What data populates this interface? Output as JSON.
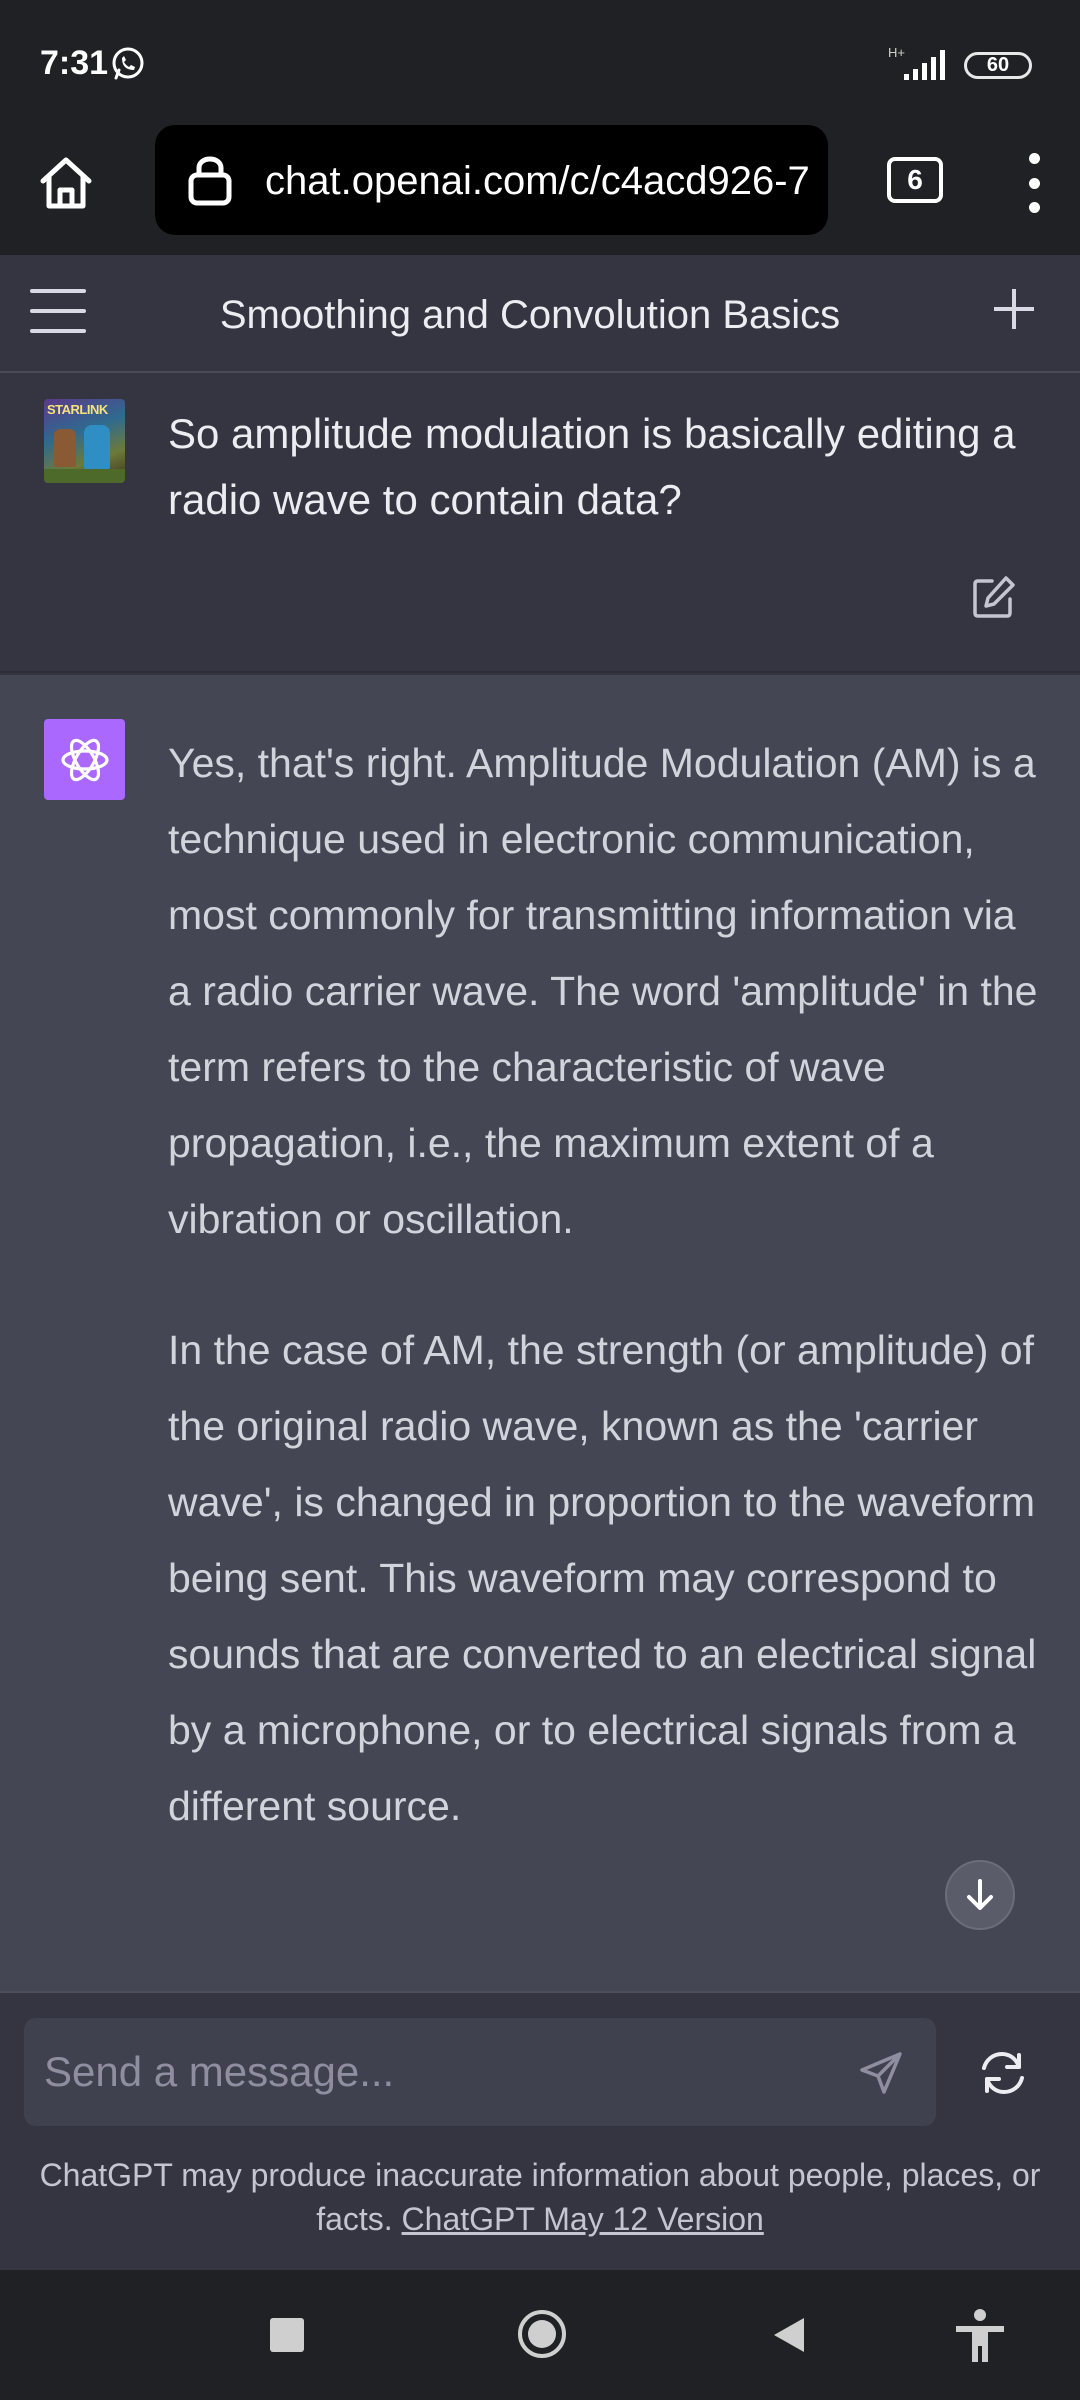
{
  "status_bar": {
    "time": "7:31",
    "network_type": "H+",
    "battery": "60"
  },
  "browser": {
    "url": "chat.openai.com/c/c4acd926-7",
    "tab_count": "6",
    "icons": [
      "home-icon",
      "lock-icon",
      "tabs-icon",
      "more-vert-icon"
    ]
  },
  "header": {
    "title": "Smoothing and Convolution Basics",
    "icons": [
      "menu-icon",
      "new-chat-icon"
    ]
  },
  "conversation": {
    "user_message": "So amplitude modulation is basically editing a radio wave to contain data?",
    "assistant_paragraphs": [
      "Yes, that's right. Amplitude Modulation (AM) is a technique used in electronic communication, most commonly for transmitting information via a radio carrier wave. The word 'amplitude' in the term refers to the characteristic of wave propagation, i.e., the maximum extent of a vibration or oscillation.",
      "In the case of AM, the strength (or amplitude) of the original radio wave, known as the 'carrier wave', is changed in proportion to the waveform being sent. This waveform may correspond to sounds that are converted to an electrical signal by a microphone, or to electrical signals from a different source."
    ]
  },
  "composer": {
    "placeholder": "Send a message...",
    "disclaimer_text": "ChatGPT may produce inaccurate information about people, places, or facts.",
    "version_link": "ChatGPT May 12 Version"
  },
  "colors": {
    "assistant_bg": "#444654",
    "user_bg": "#343541",
    "gpt_avatar": "#ab68ff"
  }
}
